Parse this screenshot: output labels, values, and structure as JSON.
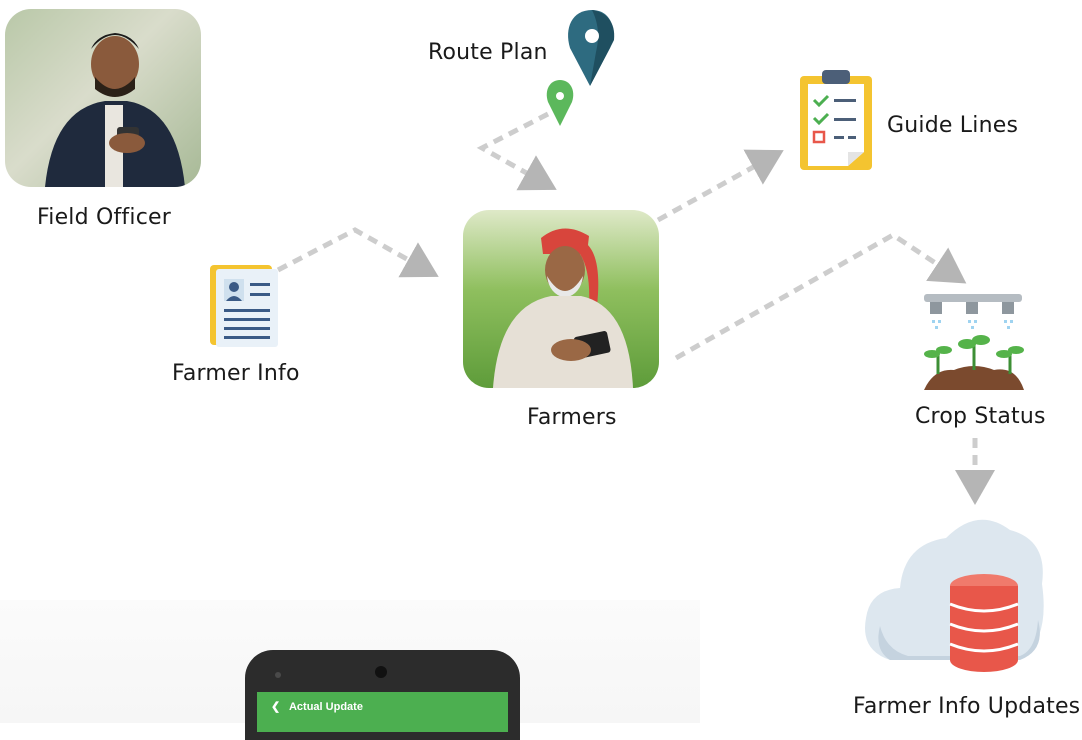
{
  "nodes": {
    "field_officer": "Field Officer",
    "route_plan": "Route Plan",
    "guide_lines": "Guide Lines",
    "farmer_info": "Farmer Info",
    "farmers": "Farmers",
    "crop_status": "Crop Status",
    "farmer_info_updates": "Farmer Info Updates"
  },
  "phone": {
    "header": "Actual Update"
  },
  "colors": {
    "arrow": "#c8c8c8",
    "pin_dark": "#2e6b80",
    "pin_green": "#5cb85c",
    "clipboard": "#f4c430",
    "database": "#e8574a",
    "cloud": "#dde7ef"
  },
  "icons": [
    "person-photo",
    "map-pin-icon",
    "clipboard-checklist-icon",
    "id-card-icon",
    "farmer-photo",
    "sprinkler-plants-icon",
    "cloud-database-icon"
  ]
}
